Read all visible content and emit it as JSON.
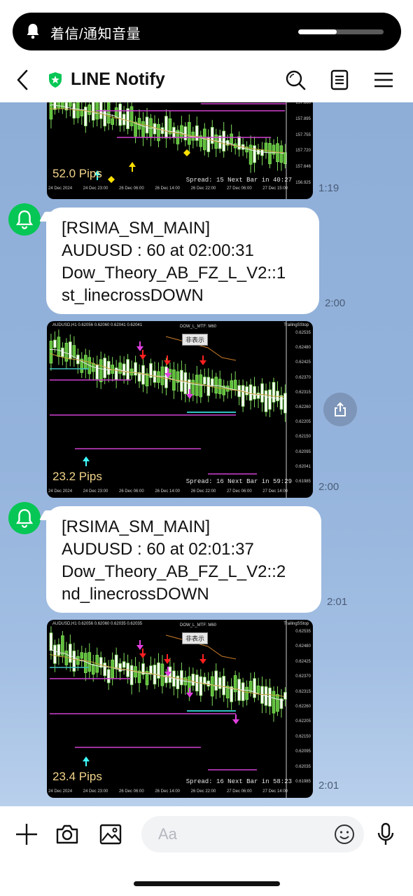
{
  "banner": {
    "label": "着信/通知音量",
    "level": 0.45
  },
  "header": {
    "title": "LINE Notify",
    "icons": [
      "back-icon",
      "verified-shield-icon",
      "search-icon",
      "notes-icon",
      "menu-icon"
    ]
  },
  "messages": [
    {
      "type": "chart",
      "pips": "52.0 Pips",
      "spread": "Spread: 15  Next Bar in 40:27",
      "xlabels": [
        "24 Dec 2024",
        "24 Dec 23:00",
        "26 Dec 06:00",
        "26 Dec 14:00",
        "26 Dec 22:00",
        "27 Dec 06:00",
        "27 Dec 15:00"
      ],
      "yticks": [
        "157.860",
        "157.895",
        "157.755",
        "157.720",
        "157.646",
        "156.925"
      ],
      "time": "1:19"
    },
    {
      "type": "text",
      "lines": [
        "[RSIMA_SM_MAIN]",
        "AUDUSD : 60 at 02:00:31",
        "Dow_Theory_AB_FZ_L_V2::1",
        "st_linecrossDOWN"
      ],
      "time": "2:00"
    },
    {
      "type": "chart",
      "symbol": "AUDUSD,H1  0.62056 0.62060 0.62041 0.62041",
      "indicator": "DOW_L_MTF: M60",
      "trailing": "TrailingSStop",
      "hide_button": "非表示",
      "pips": "23.2 Pips",
      "spread": "Spread: 16  Next Bar in 59:29",
      "xlabels": [
        "24 Dec 2024",
        "24 Dec 23:00",
        "26 Dec 06:00",
        "26 Dec 14:00",
        "26 Dec 22:00",
        "27 Dec 06:00",
        "27 Dec 14:00"
      ],
      "yticks": [
        "0.62535",
        "0.62480",
        "0.62425",
        "0.62370",
        "0.62315",
        "0.62260",
        "0.62205",
        "0.62150",
        "0.62095",
        "0.62041",
        "0.61985"
      ],
      "time": "2:00"
    },
    {
      "type": "text",
      "lines": [
        "[RSIMA_SM_MAIN]",
        "AUDUSD : 60 at 02:01:37",
        "Dow_Theory_AB_FZ_L_V2::2",
        "nd_linecrossDOWN"
      ],
      "time": "2:01"
    },
    {
      "type": "chart",
      "symbol": "AUDUSD,H1  0.62056 0.62060 0.62035 0.62035",
      "indicator": "DOW_L_MTF: M60",
      "trailing": "TrailingSStop",
      "hide_button": "非表示",
      "pips": "23.4 Pips",
      "spread": "Spread: 16  Next Bar in 58:23",
      "xlabels": [
        "24 Dec 2024",
        "24 Dec 23:00",
        "26 Dec 06:00",
        "26 Dec 14:00",
        "26 Dec 22:00",
        "27 Dec 06:00",
        "27 Dec 14:00"
      ],
      "yticks": [
        "0.62535",
        "0.62480",
        "0.62425",
        "0.62370",
        "0.62315",
        "0.62260",
        "0.62205",
        "0.62150",
        "0.62095",
        "0.62035",
        "0.61985"
      ],
      "time": "2:01"
    }
  ],
  "input": {
    "placeholder": "Aa",
    "icons": [
      "plus-icon",
      "camera-icon",
      "image-icon",
      "emoji-icon",
      "microphone-icon"
    ]
  },
  "colors": {
    "line_green": "#06c755",
    "chart_bg": "#000000",
    "pips_text": "#f2d48a",
    "arrow_magenta": "#e040e0",
    "arrow_red": "#ff2020",
    "arrow_cyan": "#40ffff",
    "bubble_bg": "#ffffff"
  }
}
